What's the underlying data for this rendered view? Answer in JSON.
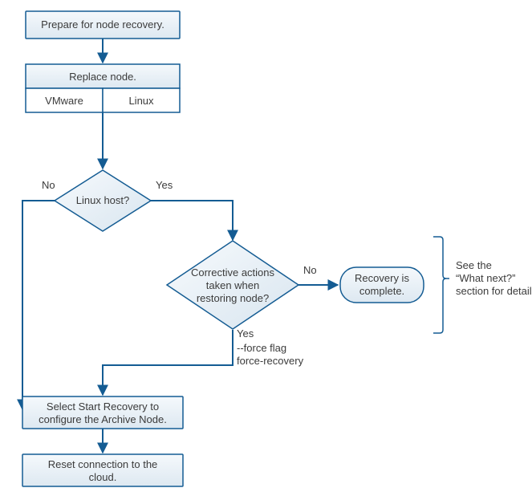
{
  "nodes": {
    "prepare": "Prepare for node recovery.",
    "replace": "Replace node.",
    "vmware": "VMware",
    "linux": "Linux",
    "linux_host_q": "Linux host?",
    "corrective_q_l1": "Corrective actions",
    "corrective_q_l2": "taken when",
    "corrective_q_l3": "restoring node?",
    "recovery_complete_l1": "Recovery is",
    "recovery_complete_l2": "complete.",
    "start_recovery_l1": "Select Start Recovery to",
    "start_recovery_l2": "configure the Archive Node.",
    "reset_cloud_l1": "Reset connection to the",
    "reset_cloud_l2": "cloud."
  },
  "edges": {
    "no": "No",
    "yes": "Yes",
    "force_l1": "--force flag",
    "force_l2": "force-recovery"
  },
  "annotation": {
    "l1": "See the",
    "l2": "“What next?”",
    "l3": "section for details."
  }
}
